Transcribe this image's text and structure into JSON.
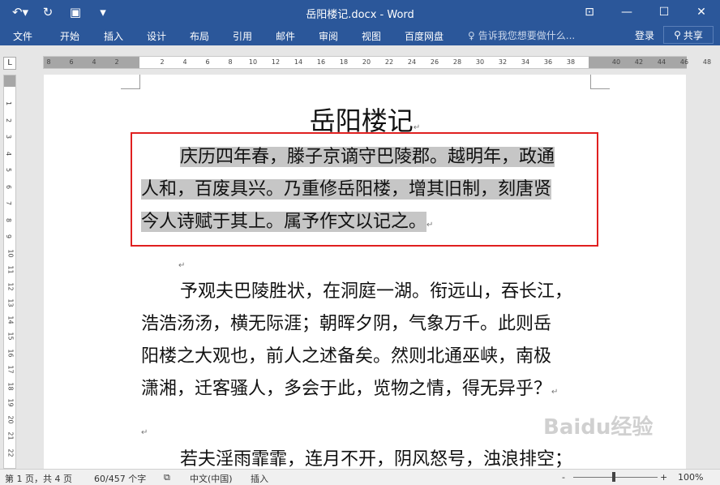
{
  "window": {
    "title": "岳阳楼记.docx - Word",
    "qat": {
      "undo_icon": "undo-icon",
      "redo_icon": "redo-icon",
      "save_icon": "save-icon",
      "customize_icon": "customize-qat-icon"
    },
    "controls": {
      "ribbon_display": "ribbon-display-icon",
      "minimize": "minimize-icon",
      "maximize": "maximize-icon",
      "close": "close-icon"
    }
  },
  "ribbon": {
    "tabs": [
      "文件",
      "开始",
      "插入",
      "设计",
      "布局",
      "引用",
      "邮件",
      "审阅",
      "视图",
      "百度网盘"
    ],
    "tell_me": "告诉我您想要做什么...",
    "login": "登录",
    "share": "共享"
  },
  "ruler": {
    "corner": "L",
    "h_ticks": [
      "8",
      "6",
      "4",
      "2",
      "",
      "2",
      "4",
      "6",
      "8",
      "10",
      "12",
      "14",
      "16",
      "18",
      "20",
      "22",
      "24",
      "26",
      "28",
      "30",
      "32",
      "34",
      "36",
      "38",
      "",
      "40",
      "42",
      "44",
      "46",
      "48"
    ],
    "v_ticks": [
      "1",
      "2",
      "3",
      "4",
      "5",
      "6",
      "7",
      "8",
      "9",
      "10",
      "11",
      "12",
      "13",
      "14",
      "15",
      "16",
      "17",
      "18",
      "19",
      "20",
      "21",
      "22"
    ]
  },
  "document": {
    "title": "岳阳楼记",
    "para1": [
      "庆历四年春，滕子京谪守巴陵郡。越明年，政通",
      "人和，百废具兴。乃重修岳阳楼，增其旧制，刻唐贤",
      "今人诗赋于其上。属予作文以记之。"
    ],
    "para2": [
      "予观夫巴陵胜状，在洞庭一湖。衔远山，吞长江，",
      "浩浩汤汤，横无际涯；朝晖夕阴，气象万千。此则岳",
      "阳楼之大观也，前人之述备矣。然则北通巫峡，南极",
      "潇湘，迁客骚人，多会于此，览物之情，得无异乎？"
    ],
    "para3": "若夫淫雨霏霏，连月不开，阴风怒号，浊浪排空；",
    "para_mark": "↵"
  },
  "status": {
    "page": "第 1 页，共 4 页",
    "words": "60/457 个字",
    "lang": "中文(中国)",
    "mode": "插入",
    "zoom": "100%",
    "zoom_minus": "-",
    "zoom_plus": "+"
  },
  "watermark": "Baidu经验"
}
